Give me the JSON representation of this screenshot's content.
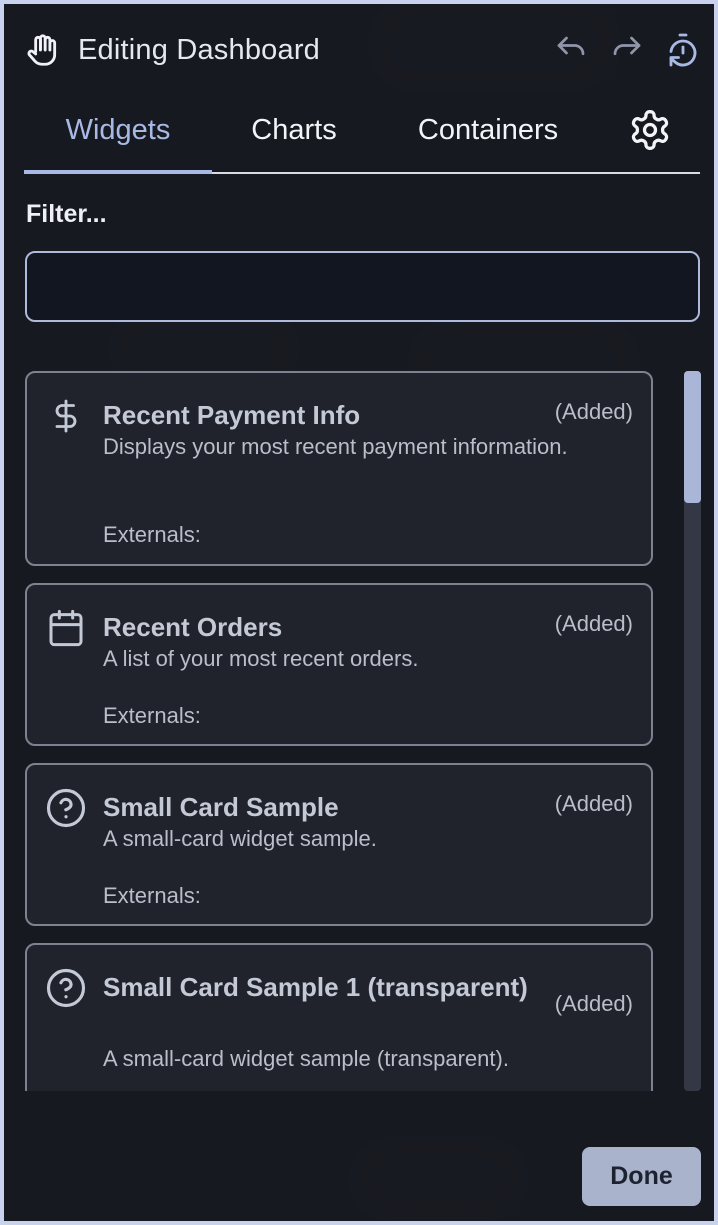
{
  "header": {
    "title": "Editing Dashboard"
  },
  "tabs": [
    {
      "label": "Widgets",
      "active": true
    },
    {
      "label": "Charts",
      "active": false
    },
    {
      "label": "Containers",
      "active": false
    }
  ],
  "filter": {
    "label": "Filter...",
    "value": "",
    "placeholder": ""
  },
  "widgets": [
    {
      "icon": "dollar-icon",
      "title": "Recent Payment Info",
      "status": "(Added)",
      "description": "Displays your most recent payment information.",
      "externals": "Externals:"
    },
    {
      "icon": "calendar-icon",
      "title": "Recent Orders",
      "status": "(Added)",
      "description": "A list of your most recent orders.",
      "externals": "Externals:"
    },
    {
      "icon": "help-circle-icon",
      "title": "Small Card Sample",
      "status": "(Added)",
      "description": "A small-card widget sample.",
      "externals": "Externals:"
    },
    {
      "icon": "help-circle-icon",
      "title": "Small Card Sample 1 (transparent)",
      "status": "(Added)",
      "description": "A small-card widget sample (transparent).",
      "externals": ""
    }
  ],
  "footer": {
    "done_label": "Done"
  },
  "colors": {
    "accent": "#a9b9e6",
    "panel_bg": "#181a21",
    "card_bg": "#20232c",
    "card_border": "#7d8290",
    "done_bg": "#a9b4cc"
  }
}
